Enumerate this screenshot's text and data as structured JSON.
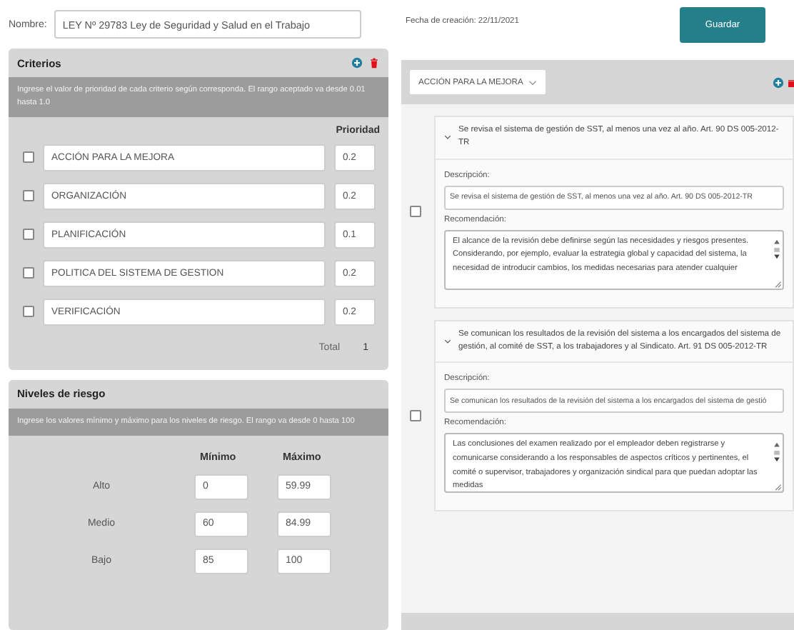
{
  "name_field": {
    "label": "Nombre:",
    "value": "LEY Nº 29783  Ley de Seguridad y Salud en el Trabajo"
  },
  "created": {
    "label": "Fecha de creación:",
    "value": "22/11/2021"
  },
  "save_button": "Guardar",
  "criteria": {
    "title": "Criterios",
    "instructions": "Ingrese el valor de prioridad de cada criterio según corresponda. El rango aceptado va desde 0.01 hasta 1.0",
    "priority_header": "Prioridad",
    "rows": [
      {
        "name": "ACCIÓN PARA LA MEJORA",
        "priority": "0.2",
        "checked": false
      },
      {
        "name": "ORGANIZACIÓN",
        "priority": "0.2",
        "checked": false
      },
      {
        "name": "PLANIFICACIÓN",
        "priority": "0.1",
        "checked": false
      },
      {
        "name": "POLITICA DEL SISTEMA DE GESTION",
        "priority": "0.2",
        "checked": false
      },
      {
        "name": "VERIFICACIÓN",
        "priority": "0.2",
        "checked": false
      }
    ],
    "total_label": "Total",
    "total": "1"
  },
  "risk_levels": {
    "title": "Niveles de riesgo",
    "instructions": "Ingrese los valores mínimo y máximo para los niveles de riesgo. El rango va desde 0 hasta 100",
    "min_header": "Mínimo",
    "max_header": "Máximo",
    "rows": [
      {
        "level": "Alto",
        "min": "0",
        "max": "59.99"
      },
      {
        "level": "Medio",
        "min": "60",
        "max": "84.99"
      },
      {
        "level": "Bajo",
        "min": "85",
        "max": "100"
      }
    ]
  },
  "criterion_select": {
    "value": "ACCIÓN PARA LA MEJORA"
  },
  "items": [
    {
      "title": "Se revisa el sistema de gestión de SST, al menos una vez al año. Art. 90 DS 005-2012-TR",
      "expanded": true,
      "checked": false,
      "description_label": "Descripción:",
      "description": "Se revisa el sistema de gestión de SST, al menos una vez al año.  Art. 90 DS 005-2012-TR",
      "recommendation_label": "Recomendación:",
      "recommendation": "El alcance de la revisión debe definirse según las necesidades y riesgos presentes. Considerando, por ejemplo, evaluar la estrategia global y capacidad del sistema, la necesidad de introducir cambios, los medidas necesarias para atender cualquier"
    },
    {
      "title": "Se comunican los resultados de la revisión del sistema a los encargados del sistema de gestión, al comité de SST, a los trabajadores y al Sindicato. Art. 91 DS 005-2012-TR",
      "expanded": true,
      "checked": false,
      "description_label": "Descripción:",
      "description": "Se comunican los resultados de la revisión del sistema a los encargados del sistema de gestió",
      "recommendation_label": "Recomendación:",
      "recommendation": "Las conclusiones del examen realizado  por el empleador deben registrarse y comunicarse considerando a los responsables de aspectos críticos y pertinentes, el comité o supervisor, trabajadores y organización sindical para que puedan adoptar las medidas"
    }
  ]
}
